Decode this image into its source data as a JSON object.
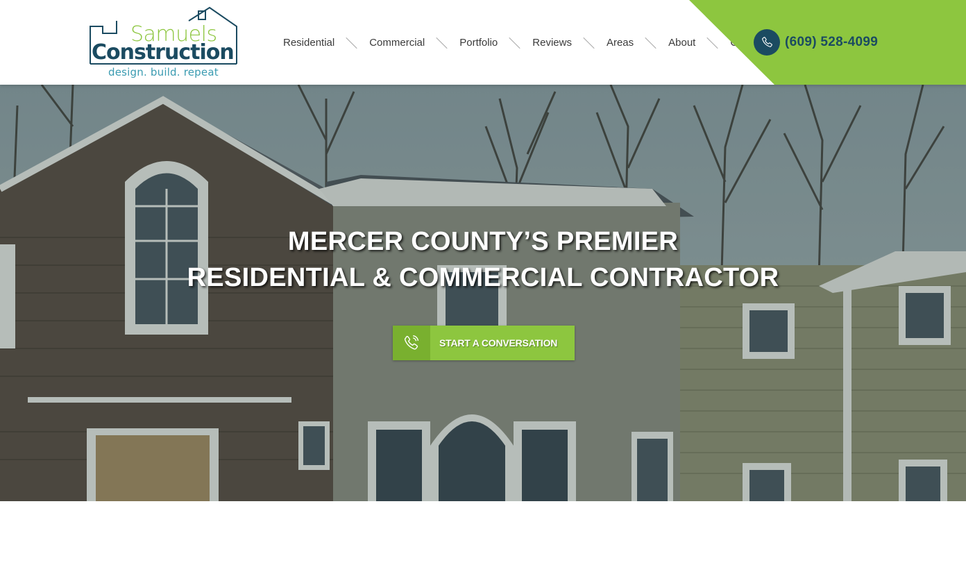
{
  "brand": {
    "name_line1": "Samuels",
    "name_line2": "Construction",
    "tagline": "design. build. repeat",
    "colors": {
      "green": "#8dc63f",
      "navy": "#1b4b61",
      "teal": "#3a9bb1"
    }
  },
  "nav": {
    "items": [
      {
        "label": "Residential"
      },
      {
        "label": "Commercial"
      },
      {
        "label": "Portfolio"
      },
      {
        "label": "Reviews"
      },
      {
        "label": "Areas"
      },
      {
        "label": "About"
      },
      {
        "label": "Contact"
      }
    ]
  },
  "header": {
    "phone": "(609) 528-4099",
    "phone_icon": "phone-icon"
  },
  "hero": {
    "title_line1": "MERCER COUNTY’S PREMIER",
    "title_line2": "RESIDENTIAL & COMMERCIAL CONTRACTOR",
    "cta_label": "START A CONVERSATION",
    "cta_icon": "phone-ringing-icon"
  }
}
